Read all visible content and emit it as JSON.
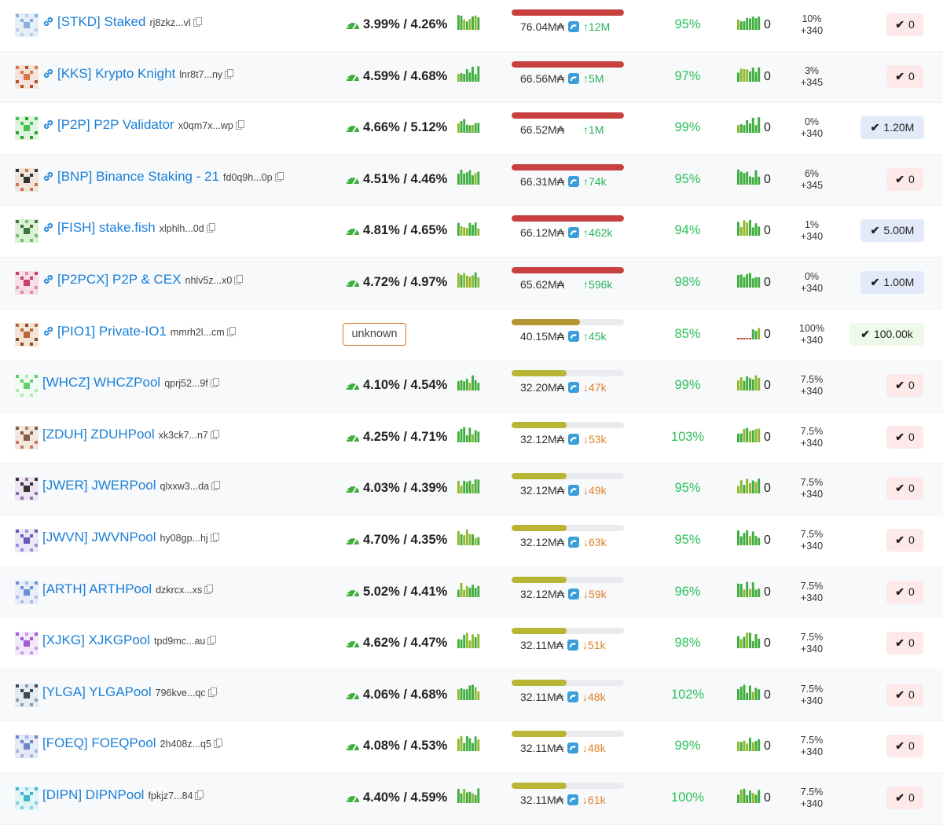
{
  "colors": {
    "link": "#1a7fd6",
    "bar_red": "#c84040",
    "bar_olive": "#b9b535",
    "bar_gold": "#b59632",
    "uptime": "#2ec05b",
    "delta_up": "#26b35a",
    "delta_down": "#e0822a"
  },
  "icons": {
    "link": "link-icon",
    "copy": "copy-icon",
    "apy": "gauge-icon",
    "coin": "dolphin-coin-icon",
    "check": "check-icon"
  },
  "currency_symbol": "₳",
  "rows": [
    {
      "ticker": "[STKD]",
      "name": "Staked",
      "addr": "rj8zkz...vl",
      "has_link": true,
      "apy": "3.99% / 4.26%",
      "apy_unknown": false,
      "stake_fill": 1.0,
      "bar_color": "#c84040",
      "stake": "76.04M",
      "coin": true,
      "delta": "12M",
      "delta_dir": "up",
      "uptime": "95%",
      "count": "0",
      "fee_pct": "10%",
      "fee_fixed": "+340",
      "badge": "0",
      "badge_type": "zero",
      "avatar": {
        "fg": "#8aaedc",
        "bg": "#e6eef8",
        "mid": "#b9cde9"
      }
    },
    {
      "ticker": "[KKS]",
      "name": "Krypto Knight",
      "addr": "lnr8t7...ny",
      "has_link": true,
      "apy": "4.59% / 4.68%",
      "apy_unknown": false,
      "stake_fill": 1.0,
      "bar_color": "#c84040",
      "stake": "66.56M",
      "coin": true,
      "delta": "5M",
      "delta_dir": "up",
      "uptime": "97%",
      "count": "0",
      "fee_pct": "3%",
      "fee_fixed": "+345",
      "badge": "0",
      "badge_type": "zero",
      "avatar": {
        "fg": "#d9784a",
        "bg": "#f4e3da",
        "mid": "#b24f2f"
      }
    },
    {
      "ticker": "[P2P]",
      "name": "P2P Validator",
      "addr": "x0qm7x...wp",
      "has_link": true,
      "apy": "4.66% / 5.12%",
      "apy_unknown": false,
      "stake_fill": 1.0,
      "bar_color": "#c84040",
      "stake": "66.52M",
      "coin": false,
      "delta": "1M",
      "delta_dir": "up",
      "uptime": "99%",
      "count": "0",
      "fee_pct": "0%",
      "fee_fixed": "+340",
      "badge": "1.20M",
      "badge_type": "blue",
      "avatar": {
        "fg": "#4cbf4c",
        "bg": "#dff4df",
        "mid": "#2f9e2f"
      }
    },
    {
      "ticker": "[BNP]",
      "name": "Binance Staking - 21",
      "addr": "fd0q9h...0p",
      "has_link": true,
      "apy": "4.51% / 4.46%",
      "apy_unknown": false,
      "stake_fill": 1.0,
      "bar_color": "#c84040",
      "stake": "66.31M",
      "coin": true,
      "delta": "74k",
      "delta_dir": "up",
      "uptime": "95%",
      "count": "0",
      "fee_pct": "6%",
      "fee_fixed": "+345",
      "badge": "0",
      "badge_type": "zero",
      "avatar": {
        "fg": "#333333",
        "bg": "#f0e4dc",
        "mid": "#c8784a"
      }
    },
    {
      "ticker": "[FISH]",
      "name": "stake.fish",
      "addr": "xlphlh...0d",
      "has_link": true,
      "apy": "4.81% / 4.65%",
      "apy_unknown": false,
      "stake_fill": 1.0,
      "bar_color": "#c84040",
      "stake": "66.12M",
      "coin": true,
      "delta": "462k",
      "delta_dir": "up",
      "uptime": "94%",
      "count": "0",
      "fee_pct": "1%",
      "fee_fixed": "+340",
      "badge": "5.00M",
      "badge_type": "blue",
      "avatar": {
        "fg": "#3c7a3c",
        "bg": "#dff0d8",
        "mid": "#6fc26f"
      }
    },
    {
      "ticker": "[P2PCX]",
      "name": "P2P & CEX",
      "addr": "nhlv5z...x0",
      "has_link": true,
      "apy": "4.72% / 4.97%",
      "apy_unknown": false,
      "stake_fill": 1.0,
      "bar_color": "#c84040",
      "stake": "65.62M",
      "coin": false,
      "delta": "596k",
      "delta_dir": "up",
      "uptime": "98%",
      "count": "0",
      "fee_pct": "0%",
      "fee_fixed": "+340",
      "badge": "1.00M",
      "badge_type": "blue",
      "avatar": {
        "fg": "#c24468",
        "bg": "#f7dde5",
        "mid": "#e08aa3"
      }
    },
    {
      "ticker": "[PIO1]",
      "name": "Private-IO1",
      "addr": "mmrh2l...cm",
      "has_link": true,
      "apy": "unknown",
      "apy_unknown": true,
      "stake_fill": 0.61,
      "bar_color": "#b59632",
      "stake": "40.15M",
      "coin": true,
      "delta": "45k",
      "delta_dir": "up",
      "uptime": "85%",
      "count": "0",
      "fee_pct": "100%",
      "fee_fixed": "+340",
      "badge": "100.00k",
      "badge_type": "green",
      "avatar": {
        "fg": "#b5683c",
        "bg": "#f4e4d6",
        "mid": "#8b4a2a"
      }
    },
    {
      "ticker": "[WHCZ]",
      "name": "WHCZPool",
      "addr": "qprj52...9f",
      "has_link": false,
      "apy": "4.10% / 4.54%",
      "apy_unknown": false,
      "stake_fill": 0.49,
      "bar_color": "#b9b535",
      "stake": "32.20M",
      "coin": true,
      "delta": "47k",
      "delta_dir": "down",
      "uptime": "99%",
      "count": "0",
      "fee_pct": "7.5%",
      "fee_fixed": "+340",
      "badge": "0",
      "badge_type": "zero",
      "avatar": {
        "fg": "#5fcf6f",
        "bg": "#f2fbf3",
        "mid": "#aee8b6"
      }
    },
    {
      "ticker": "[ZDUH]",
      "name": "ZDUHPool",
      "addr": "xk3ck7...n7",
      "has_link": false,
      "apy": "4.25% / 4.71%",
      "apy_unknown": false,
      "stake_fill": 0.49,
      "bar_color": "#b9b535",
      "stake": "32.12M",
      "coin": true,
      "delta": "53k",
      "delta_dir": "down",
      "uptime": "103%",
      "count": "0",
      "fee_pct": "7.5%",
      "fee_fixed": "+340",
      "badge": "0",
      "badge_type": "zero",
      "avatar": {
        "fg": "#8a5a44",
        "bg": "#f1e6e0",
        "mid": "#c47c5c"
      }
    },
    {
      "ticker": "[JWER]",
      "name": "JWERPool",
      "addr": "qlxxw3...da",
      "has_link": false,
      "apy": "4.03% / 4.39%",
      "apy_unknown": false,
      "stake_fill": 0.49,
      "bar_color": "#b9b535",
      "stake": "32.12M",
      "coin": true,
      "delta": "49k",
      "delta_dir": "down",
      "uptime": "95%",
      "count": "0",
      "fee_pct": "7.5%",
      "fee_fixed": "+340",
      "badge": "0",
      "badge_type": "zero",
      "avatar": {
        "fg": "#333333",
        "bg": "#ece6f3",
        "mid": "#8c6fb3"
      }
    },
    {
      "ticker": "[JWVN]",
      "name": "JWVNPool",
      "addr": "hy08gp...hj",
      "has_link": false,
      "apy": "4.70% / 4.35%",
      "apy_unknown": false,
      "stake_fill": 0.49,
      "bar_color": "#b9b535",
      "stake": "32.12M",
      "coin": true,
      "delta": "63k",
      "delta_dir": "down",
      "uptime": "95%",
      "count": "0",
      "fee_pct": "7.5%",
      "fee_fixed": "+340",
      "badge": "0",
      "badge_type": "zero",
      "avatar": {
        "fg": "#6a5bb8",
        "bg": "#ebe8f7",
        "mid": "#9a8fd6"
      }
    },
    {
      "ticker": "[ARTH]",
      "name": "ARTHPool",
      "addr": "dzkrcx...xs",
      "has_link": false,
      "apy": "5.02% / 4.41%",
      "apy_unknown": false,
      "stake_fill": 0.49,
      "bar_color": "#b9b535",
      "stake": "32.12M",
      "coin": true,
      "delta": "59k",
      "delta_dir": "down",
      "uptime": "96%",
      "count": "0",
      "fee_pct": "7.5%",
      "fee_fixed": "+340",
      "badge": "0",
      "badge_type": "zero",
      "avatar": {
        "fg": "#6a8fd6",
        "bg": "#e8eef9",
        "mid": "#a6bde8"
      }
    },
    {
      "ticker": "[XJKG]",
      "name": "XJKGPool",
      "addr": "tpd9mc...au",
      "has_link": false,
      "apy": "4.62% / 4.47%",
      "apy_unknown": false,
      "stake_fill": 0.49,
      "bar_color": "#b9b535",
      "stake": "32.11M",
      "coin": true,
      "delta": "51k",
      "delta_dir": "down",
      "uptime": "98%",
      "count": "0",
      "fee_pct": "7.5%",
      "fee_fixed": "+340",
      "badge": "0",
      "badge_type": "zero",
      "avatar": {
        "fg": "#a25ad6",
        "bg": "#f3e9fa",
        "mid": "#c89ae8"
      }
    },
    {
      "ticker": "[YLGA]",
      "name": "YLGAPool",
      "addr": "796kve...qc",
      "has_link": false,
      "apy": "4.06% / 4.68%",
      "apy_unknown": false,
      "stake_fill": 0.49,
      "bar_color": "#b9b535",
      "stake": "32.11M",
      "coin": true,
      "delta": "48k",
      "delta_dir": "down",
      "uptime": "102%",
      "count": "0",
      "fee_pct": "7.5%",
      "fee_fixed": "+340",
      "badge": "0",
      "badge_type": "zero",
      "avatar": {
        "fg": "#3b4a5c",
        "bg": "#e6ebf1",
        "mid": "#8aa0b8"
      }
    },
    {
      "ticker": "[FOEQ]",
      "name": "FOEQPool",
      "addr": "2h408z...q5",
      "has_link": false,
      "apy": "4.08% / 4.53%",
      "apy_unknown": false,
      "stake_fill": 0.49,
      "bar_color": "#b9b535",
      "stake": "32.11M",
      "coin": true,
      "delta": "48k",
      "delta_dir": "down",
      "uptime": "99%",
      "count": "0",
      "fee_pct": "7.5%",
      "fee_fixed": "+340",
      "badge": "0",
      "badge_type": "zero",
      "avatar": {
        "fg": "#6f86c8",
        "bg": "#e5eaf6",
        "mid": "#a3b3e0"
      }
    },
    {
      "ticker": "[DIPN]",
      "name": "DIPNPool",
      "addr": "fpkjz7...84",
      "has_link": false,
      "apy": "4.40% / 4.59%",
      "apy_unknown": false,
      "stake_fill": 0.49,
      "bar_color": "#b9b535",
      "stake": "32.11M",
      "coin": true,
      "delta": "61k",
      "delta_dir": "down",
      "uptime": "100%",
      "count": "0",
      "fee_pct": "7.5%",
      "fee_fixed": "+340",
      "badge": "0",
      "badge_type": "zero",
      "avatar": {
        "fg": "#3fb7c9",
        "bg": "#e1f4f7",
        "mid": "#7fd3df"
      }
    }
  ]
}
